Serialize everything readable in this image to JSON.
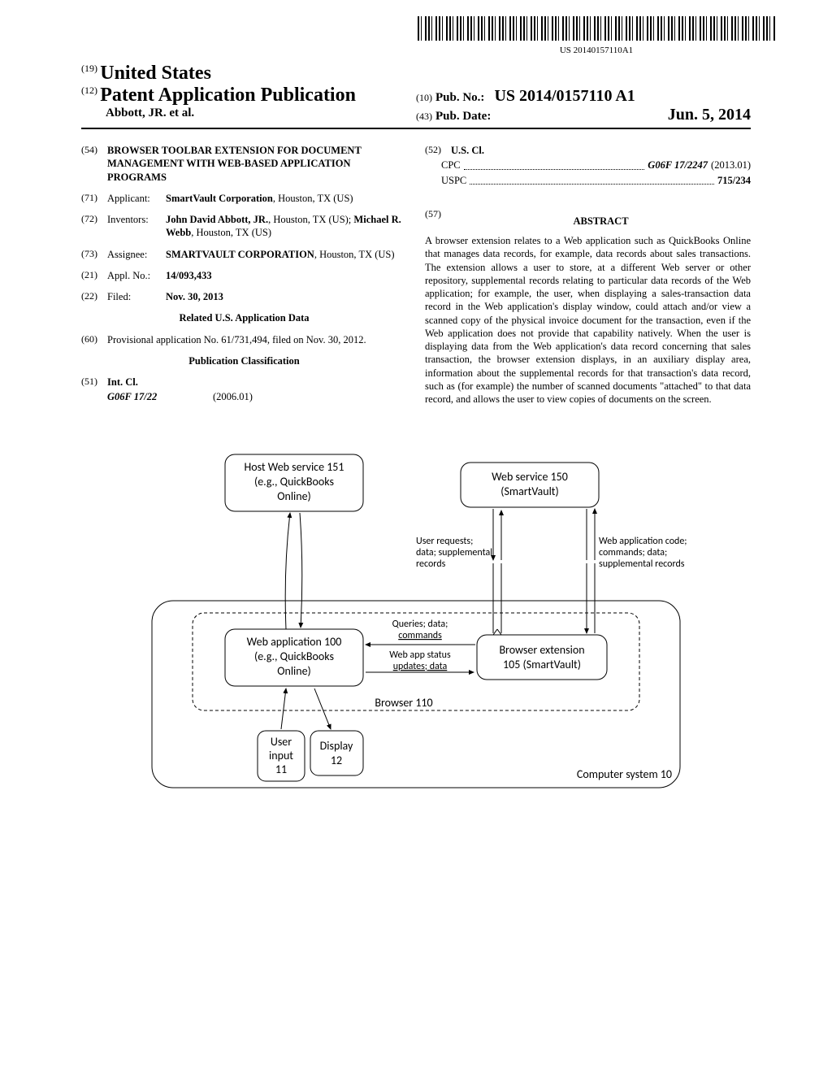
{
  "barcode_text": "US 20140157110A1",
  "header": {
    "prefix19": "(19)",
    "country": "United States",
    "prefix12": "(12)",
    "pub_type": "Patent Application Publication",
    "authors": "Abbott, JR. et al.",
    "prefix10": "(10)",
    "pubno_label": "Pub. No.:",
    "pubno": "US 2014/0157110 A1",
    "prefix43": "(43)",
    "pubdate_label": "Pub. Date:",
    "pubdate": "Jun. 5, 2014"
  },
  "left": {
    "title_code": "(54)",
    "title": "BROWSER TOOLBAR EXTENSION FOR DOCUMENT MANAGEMENT WITH WEB-BASED APPLICATION PROGRAMS",
    "applicant_code": "(71)",
    "applicant_label": "Applicant:",
    "applicant": "SmartVault Corporation",
    "applicant_loc": ", Houston, TX (US)",
    "inventors_code": "(72)",
    "inventors_label": "Inventors:",
    "inventors_html": "John David Abbott, JR.",
    "inventors_rest": ", Houston, TX (US); ",
    "inventors_html2": "Michael R. Webb",
    "inventors_rest2": ", Houston, TX (US)",
    "assignee_code": "(73)",
    "assignee_label": "Assignee:",
    "assignee": "SMARTVAULT CORPORATION",
    "assignee_loc": ", Houston, TX (US)",
    "applno_code": "(21)",
    "applno_label": "Appl. No.:",
    "applno": "14/093,433",
    "filed_code": "(22)",
    "filed_label": "Filed:",
    "filed": "Nov. 30, 2013",
    "related_heading": "Related U.S. Application Data",
    "prov_code": "(60)",
    "prov_text": "Provisional application No. 61/731,494, filed on Nov. 30, 2012.",
    "class_heading": "Publication Classification",
    "intcl_code": "(51)",
    "intcl_label": "Int. Cl.",
    "intcl_val": "G06F 17/22",
    "intcl_year": "(2006.01)"
  },
  "right": {
    "uscl_code": "(52)",
    "uscl_label": "U.S. Cl.",
    "cpc_label": "CPC",
    "cpc_val": "G06F 17/2247",
    "cpc_year": "(2013.01)",
    "uspc_label": "USPC",
    "uspc_val": "715/234",
    "abstract_code": "(57)",
    "abstract_heading": "ABSTRACT",
    "abstract": "A browser extension relates to a Web application such as QuickBooks Online that manages data records, for example, data records about sales transactions. The extension allows a user to store, at a different Web server or other repository, supplemental records relating to particular data records of the Web application; for example, the user, when displaying a sales-transaction data record in the Web application's display window, could attach and/or view a scanned copy of the physical invoice document for the transaction, even if the Web application does not provide that capability natively. When the user is displaying data from the Web application's data record concerning that sales transaction, the browser extension displays, in an auxiliary display area, information about the supplemental records for that transaction's data record, such as (for example) the number of scanned documents \"attached\" to that data record, and allows the user to view copies of documents on the screen."
  },
  "figure": {
    "box1_l1": "Host Web service 151",
    "box1_l2": "(e.g., QuickBooks",
    "box1_l3": "Online)",
    "box2_l1": "Web service 150",
    "box2_l2": "(SmartVault)",
    "note1_l1": "User requests;",
    "note1_l2": "data; supplemental",
    "note1_l3": "records",
    "note2_l1": "Web application code;",
    "note2_l2": "commands; data;",
    "note2_l3": "supplemental records",
    "box3_l1": "Web application 100",
    "box3_l2": "(e.g., QuickBooks",
    "box3_l3": "Online)",
    "box4_l1": "Browser extension",
    "box4_l2": "105 (SmartVault)",
    "mid1_l1": "Queries; data;",
    "mid1_l2": "commands",
    "mid2_l1": "Web app status",
    "mid2_l2": "updates; data",
    "browser": "Browser 110",
    "user_l1": "User",
    "user_l2": "input",
    "user_l3": "11",
    "disp_l1": "Display",
    "disp_l2": "12",
    "system": "Computer system 10"
  }
}
